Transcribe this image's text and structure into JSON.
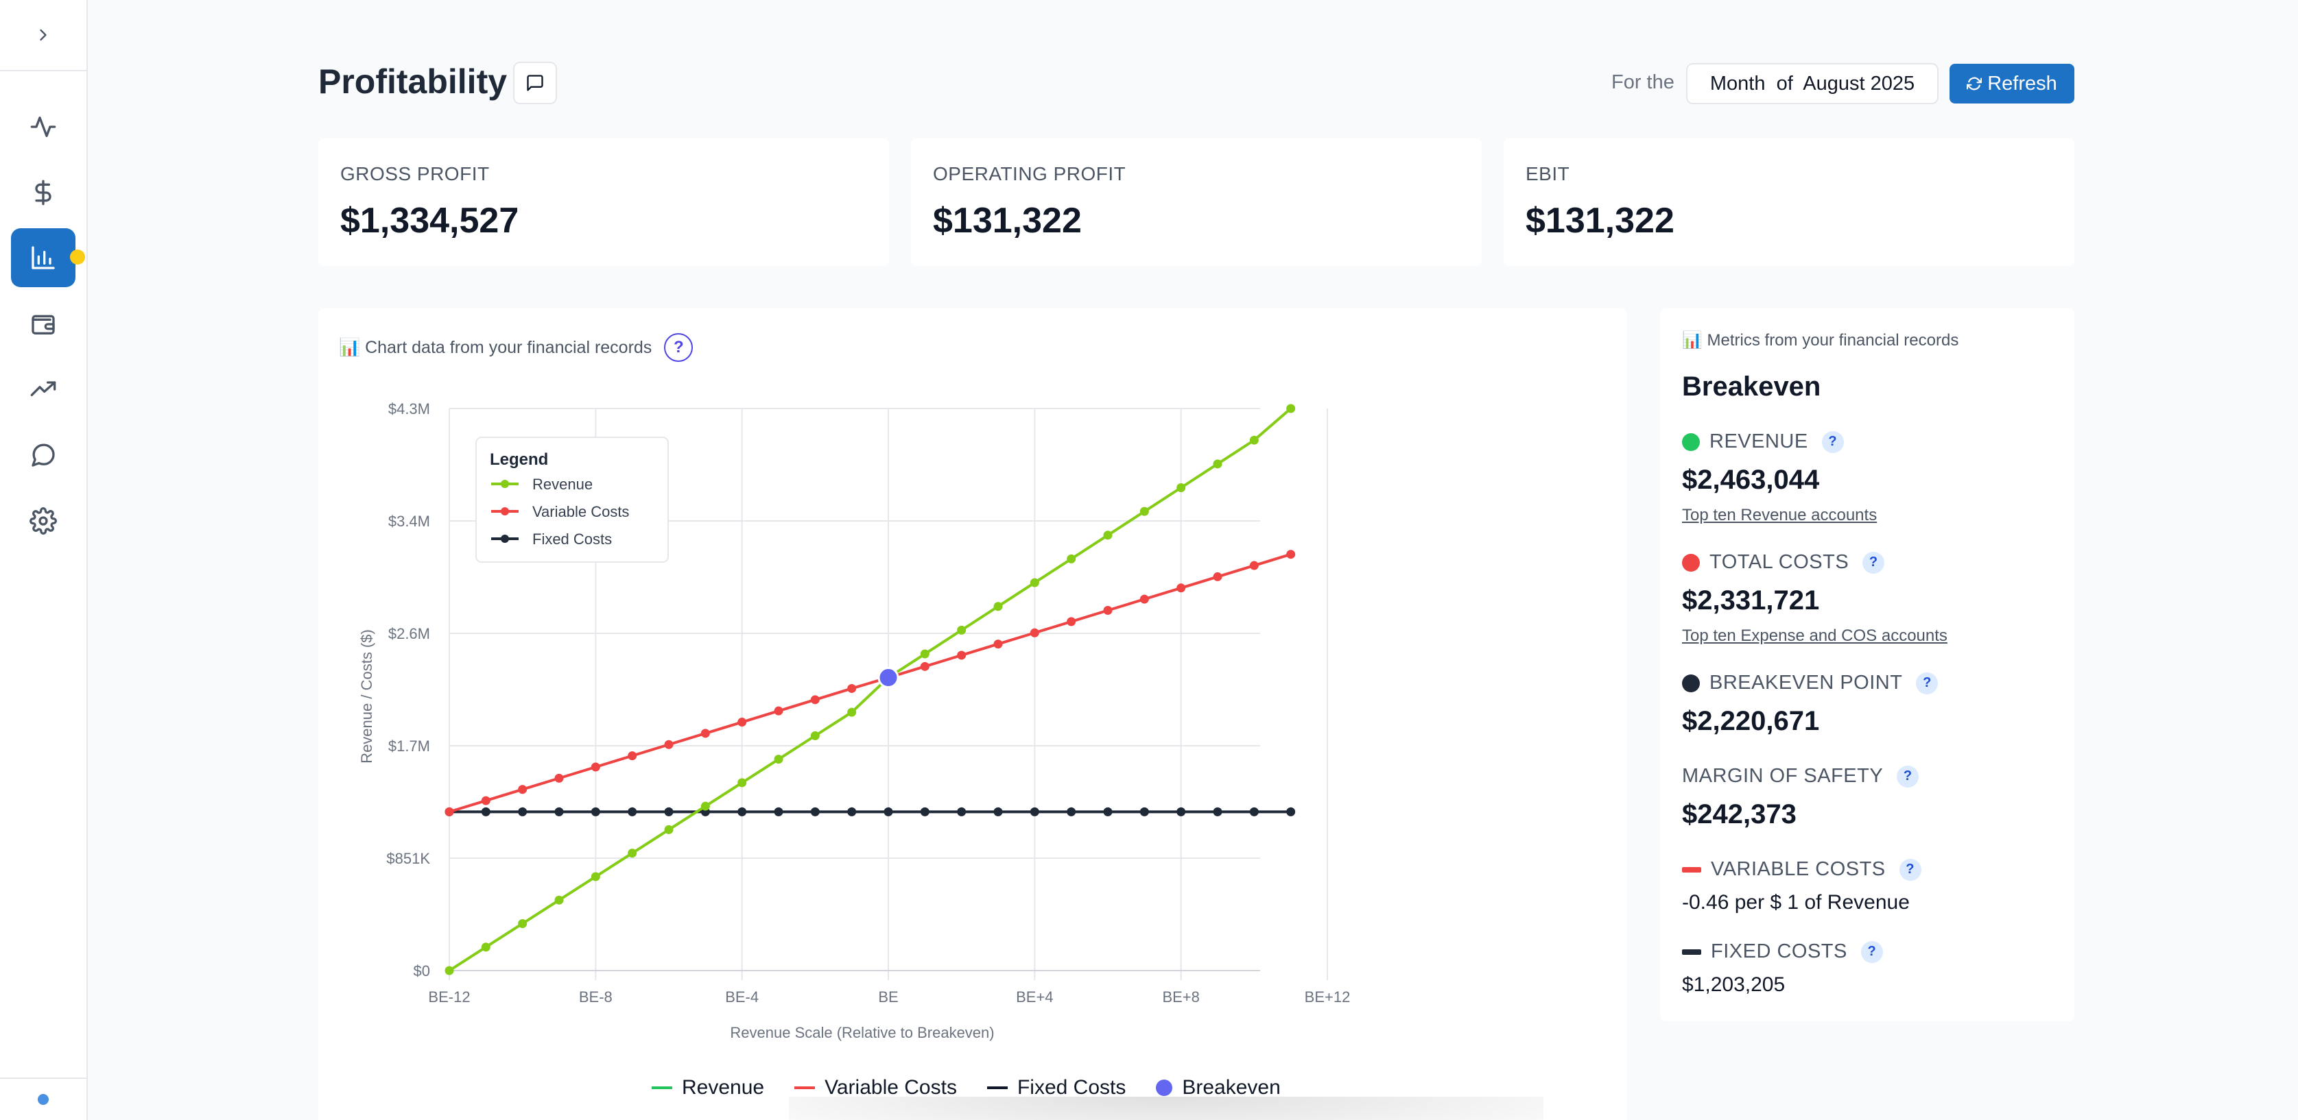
{
  "header": {
    "title": "Profitability",
    "for_the": "For the",
    "period": "Month  of  August 2025",
    "refresh_label": "Refresh"
  },
  "sidebar": {
    "items": [
      {
        "icon": "activity-icon"
      },
      {
        "icon": "dollar-icon"
      },
      {
        "icon": "bar-chart-icon",
        "active": true
      },
      {
        "icon": "wallet-icon"
      },
      {
        "icon": "trending-up-icon"
      },
      {
        "icon": "message-icon"
      },
      {
        "icon": "gear-icon"
      }
    ]
  },
  "kpis": [
    {
      "label": "GROSS PROFIT",
      "value": "$1,334,527"
    },
    {
      "label": "OPERATING PROFIT",
      "value": "$131,322"
    },
    {
      "label": "EBIT",
      "value": "$131,322"
    }
  ],
  "chart_panel": {
    "source_text": "📊 Chart data from your financial records",
    "help": "?"
  },
  "chart_data": {
    "type": "line",
    "title": "",
    "xlabel": "Revenue Scale (Relative to Breakeven)",
    "ylabel": "Revenue / Costs ($)",
    "x_ticks": [
      "BE-12",
      "BE-8",
      "BE-4",
      "BE",
      "BE+4",
      "BE+8",
      "BE+12"
    ],
    "x_range": [
      -12,
      12
    ],
    "y_ticks": [
      "$0",
      "$851K",
      "$1.7M",
      "$2.6M",
      "$3.4M",
      "$4.3M"
    ],
    "y_range": [
      0,
      4260000
    ],
    "grid": true,
    "x": [
      -12,
      -11,
      -10,
      -9,
      -8,
      -7,
      -6,
      -5,
      -4,
      -3,
      -2,
      -1,
      0,
      1,
      2,
      3,
      4,
      5,
      6,
      7,
      8,
      9,
      10,
      11
    ],
    "series": [
      {
        "name": "Revenue",
        "color": "#84cc16",
        "values": [
          0,
          178000,
          356000,
          534000,
          712000,
          890000,
          1068000,
          1246000,
          1424000,
          1602000,
          1780000,
          1958000,
          2220671,
          2400000,
          2580000,
          2760000,
          2940000,
          3120000,
          3300000,
          3480000,
          3660000,
          3840000,
          4020000,
          4260000
        ]
      },
      {
        "name": "Variable Costs",
        "color": "#ef4444",
        "values": [
          1203205,
          1288000,
          1373000,
          1458000,
          1543000,
          1628000,
          1713000,
          1798000,
          1883000,
          1968000,
          2053000,
          2138000,
          2220671,
          2305000,
          2390000,
          2475000,
          2560000,
          2645000,
          2730000,
          2815000,
          2900000,
          2985000,
          3070000,
          3155000
        ]
      },
      {
        "name": "Fixed Costs",
        "color": "#1f2937",
        "values": [
          1203205,
          1203205,
          1203205,
          1203205,
          1203205,
          1203205,
          1203205,
          1203205,
          1203205,
          1203205,
          1203205,
          1203205,
          1203205,
          1203205,
          1203205,
          1203205,
          1203205,
          1203205,
          1203205,
          1203205,
          1203205,
          1203205,
          1203205,
          1203205
        ]
      }
    ],
    "breakeven": {
      "x": 0,
      "y": 2220671,
      "name": "Breakeven",
      "color": "#6366f1"
    },
    "inner_legend_title": "Legend",
    "legend_placement": "top-left",
    "bottom_legend": [
      {
        "label": "Revenue",
        "color": "#22c55e",
        "kind": "line"
      },
      {
        "label": "Variable Costs",
        "color": "#ef4444",
        "kind": "line"
      },
      {
        "label": "Fixed Costs",
        "color": "#111827",
        "kind": "line"
      },
      {
        "label": "Breakeven",
        "color": "#6366f1",
        "kind": "dot"
      }
    ]
  },
  "metrics": {
    "source_text": "📊 Metrics from your financial records",
    "title": "Breakeven",
    "revenue": {
      "label": "REVENUE",
      "value": "$2,463,044",
      "link": "Top ten Revenue accounts",
      "color": "#22c55e"
    },
    "total_costs": {
      "label": "TOTAL COSTS",
      "value": "$2,331,721",
      "link": "Top ten Expense and COS accounts",
      "color": "#ef4444"
    },
    "breakeven_point": {
      "label": "BREAKEVEN POINT",
      "value": "$2,220,671",
      "color": "#1f2937"
    },
    "margin_of_safety": {
      "label": "MARGIN OF SAFETY",
      "value": "$242,373"
    },
    "variable_costs": {
      "label": "VARIABLE COSTS",
      "value": "-0.46 per $ 1 of Revenue",
      "color": "#ef4444"
    },
    "fixed_costs": {
      "label": "FIXED COSTS",
      "value": "$1,203,205",
      "color": "#1f2937"
    },
    "help": "?"
  }
}
